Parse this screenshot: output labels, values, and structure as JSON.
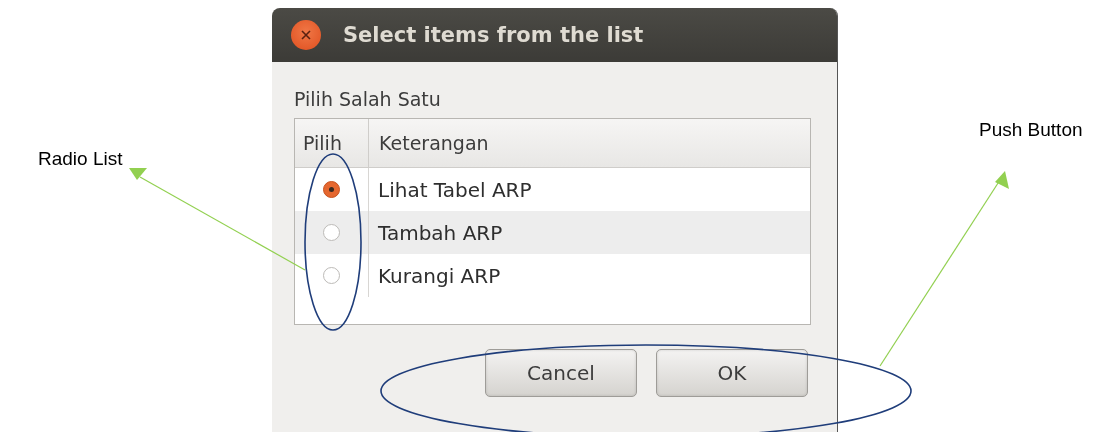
{
  "window": {
    "title": "Select items from the list"
  },
  "prompt": "Pilih Salah Satu",
  "table": {
    "columns": [
      "Pilih",
      "Keterangan"
    ],
    "rows": [
      {
        "label": "Lihat Tabel ARP",
        "selected": true
      },
      {
        "label": "Tambah ARP",
        "selected": false
      },
      {
        "label": "Kurangi ARP",
        "selected": false
      }
    ]
  },
  "buttons": [
    "Cancel",
    "OK"
  ],
  "annotations": [
    {
      "text": "Radio List"
    },
    {
      "text": "Push Button"
    }
  ]
}
